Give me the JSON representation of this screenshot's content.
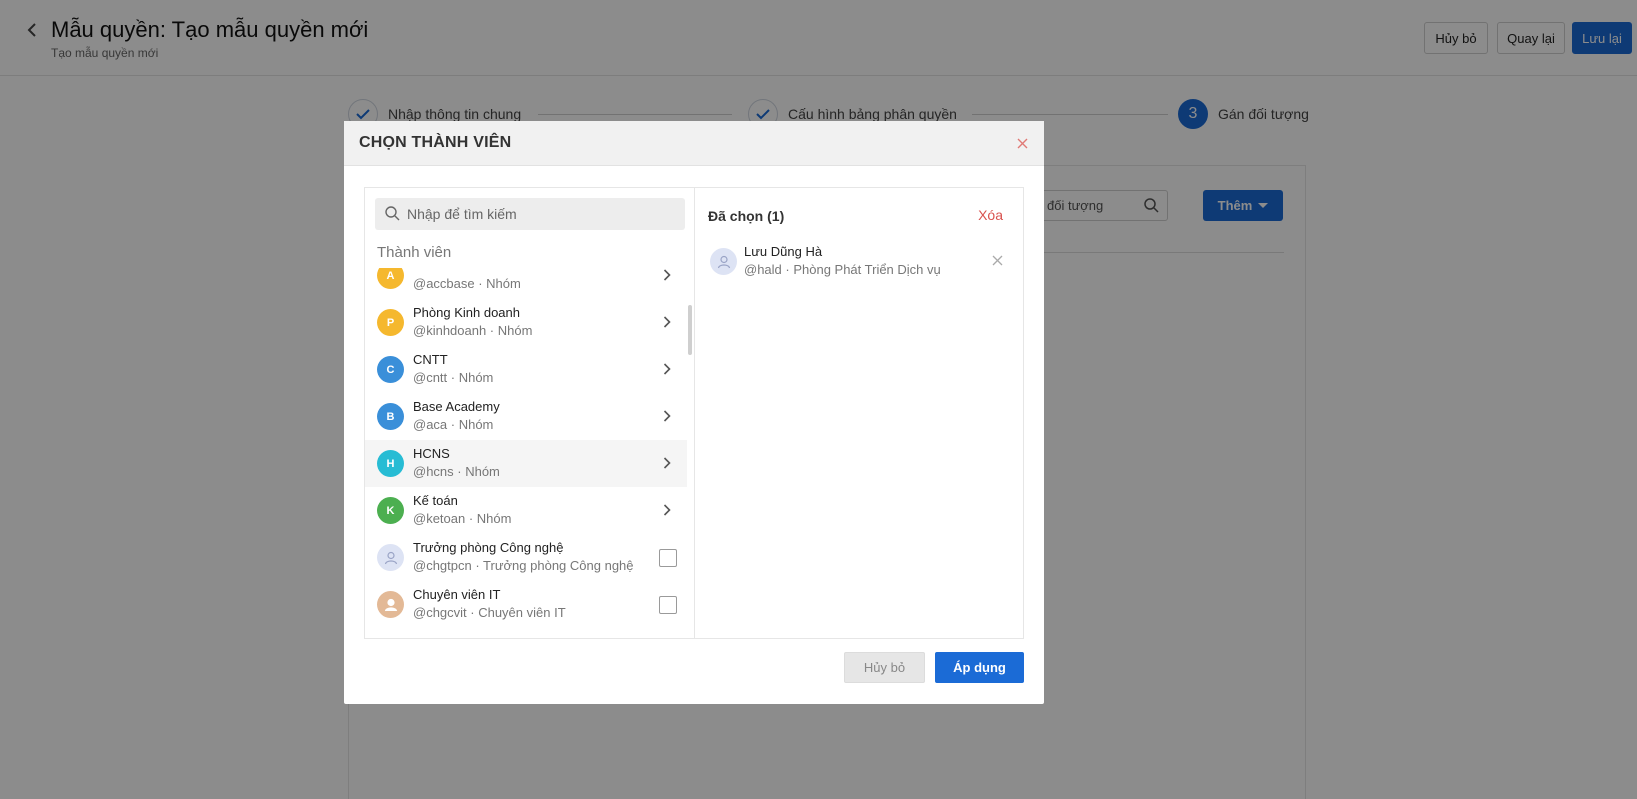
{
  "page": {
    "title": "Mẫu quyền: Tạo mẫu quyền mới",
    "subtitle": "Tạo mẫu quyền mới",
    "buttons": {
      "cancel": "Hủy bỏ",
      "back": "Quay lại",
      "save": "Lưu lại"
    }
  },
  "steps": [
    {
      "label": "Nhập thông tin chung",
      "state": "done"
    },
    {
      "label": "Cấu hình bảng phân quyền",
      "state": "done"
    },
    {
      "number": "3",
      "label": "Gán đối tượng",
      "state": "active"
    }
  ],
  "background": {
    "search_placeholder": "đối tượng",
    "add_button": "Thêm"
  },
  "modal": {
    "title": "CHỌN THÀNH VIÊN",
    "search_placeholder": "Nhập để tìm kiếm",
    "section_label": "Thành viên",
    "items": [
      {
        "initial": "A",
        "color": "#f5b82e",
        "name": "",
        "sub": "@accbase · Nhóm",
        "type": "group"
      },
      {
        "initial": "P",
        "color": "#f5b82e",
        "name": "Phòng Kinh doanh",
        "sub": "@kinhdoanh · Nhóm",
        "type": "group"
      },
      {
        "initial": "C",
        "color": "#3a8fd9",
        "name": "CNTT",
        "sub": "@cntt · Nhóm",
        "type": "group"
      },
      {
        "initial": "B",
        "color": "#3a8fd9",
        "name": "Base Academy",
        "sub": "@aca · Nhóm",
        "type": "group"
      },
      {
        "initial": "H",
        "color": "#27bcd4",
        "name": "HCNS",
        "sub": "@hcns · Nhóm",
        "type": "group"
      },
      {
        "initial": "K",
        "color": "#4caf50",
        "name": "Kế toán",
        "sub": "@ketoan · Nhóm",
        "type": "group"
      },
      {
        "initial": "",
        "color": "#dde3f4",
        "name": "Trưởng phòng Công nghệ",
        "sub": "@chgtpcn · Trưởng phòng Công nghệ",
        "type": "user"
      },
      {
        "initial": "",
        "color": "#e3b996",
        "name": "Chuyên viên IT",
        "sub": "@chgcvit · Chuyên viên IT",
        "type": "user"
      }
    ],
    "selected_title": "Đã chọn (1)",
    "clear_label": "Xóa",
    "selected": [
      {
        "name": "Lưu Dũng Hà",
        "sub": "@hald · Phòng Phát Triển Dịch vụ"
      }
    ],
    "cancel_label": "Hủy bỏ",
    "apply_label": "Áp dụng"
  },
  "colors": {
    "primary": "#1b6bd6",
    "danger": "#d9534f"
  }
}
